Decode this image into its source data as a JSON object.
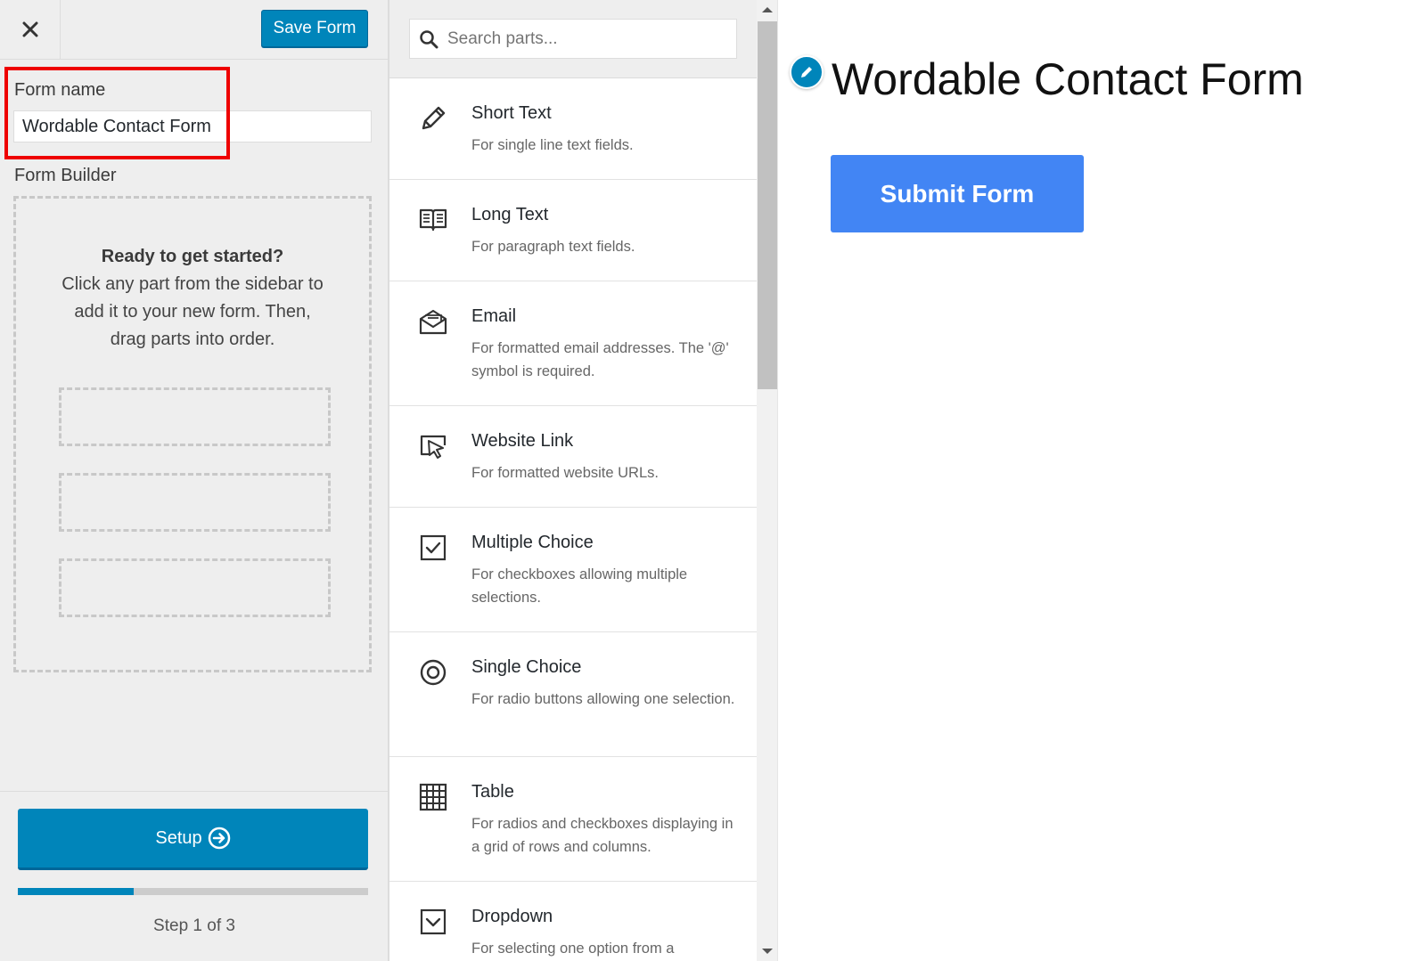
{
  "toolbar": {
    "save_label": "Save Form"
  },
  "form_name": {
    "label": "Form name",
    "value": "Wordable Contact Form"
  },
  "builder": {
    "label": "Form Builder",
    "heading": "Ready to get started?",
    "line1": "Click any part from the sidebar to",
    "line2": "add it to your new form. Then,",
    "line3": "drag parts into order."
  },
  "footer": {
    "setup_label": "Setup",
    "step_text": "Step 1 of 3",
    "progress": 0.33
  },
  "search": {
    "placeholder": "Search parts..."
  },
  "parts": [
    {
      "title": "Short Text",
      "desc": "For single line text fields.",
      "icon": "pencil-icon"
    },
    {
      "title": "Long Text",
      "desc": "For paragraph text fields.",
      "icon": "book-icon"
    },
    {
      "title": "Email",
      "desc": "For formatted email addresses. The '@' symbol is required.",
      "icon": "envelope-icon"
    },
    {
      "title": "Website Link",
      "desc": "For formatted website URLs.",
      "icon": "cursor-link-icon"
    },
    {
      "title": "Multiple Choice",
      "desc": "For checkboxes allowing multiple selections.",
      "icon": "checkbox-icon"
    },
    {
      "title": "Single Choice",
      "desc": "For radio buttons allowing one selection.",
      "icon": "radio-icon"
    },
    {
      "title": "Table",
      "desc": "For radios and checkboxes displaying in a grid of rows and columns.",
      "icon": "grid-icon"
    },
    {
      "title": "Dropdown",
      "desc": "For selecting one option from a dropdown.",
      "icon": "dropdown-icon"
    }
  ],
  "preview": {
    "title": "Wordable Contact Form",
    "submit_label": "Submit Form"
  },
  "colors": {
    "primary": "#0085ba",
    "submit": "#4285f4",
    "highlight": "#ee0000"
  }
}
